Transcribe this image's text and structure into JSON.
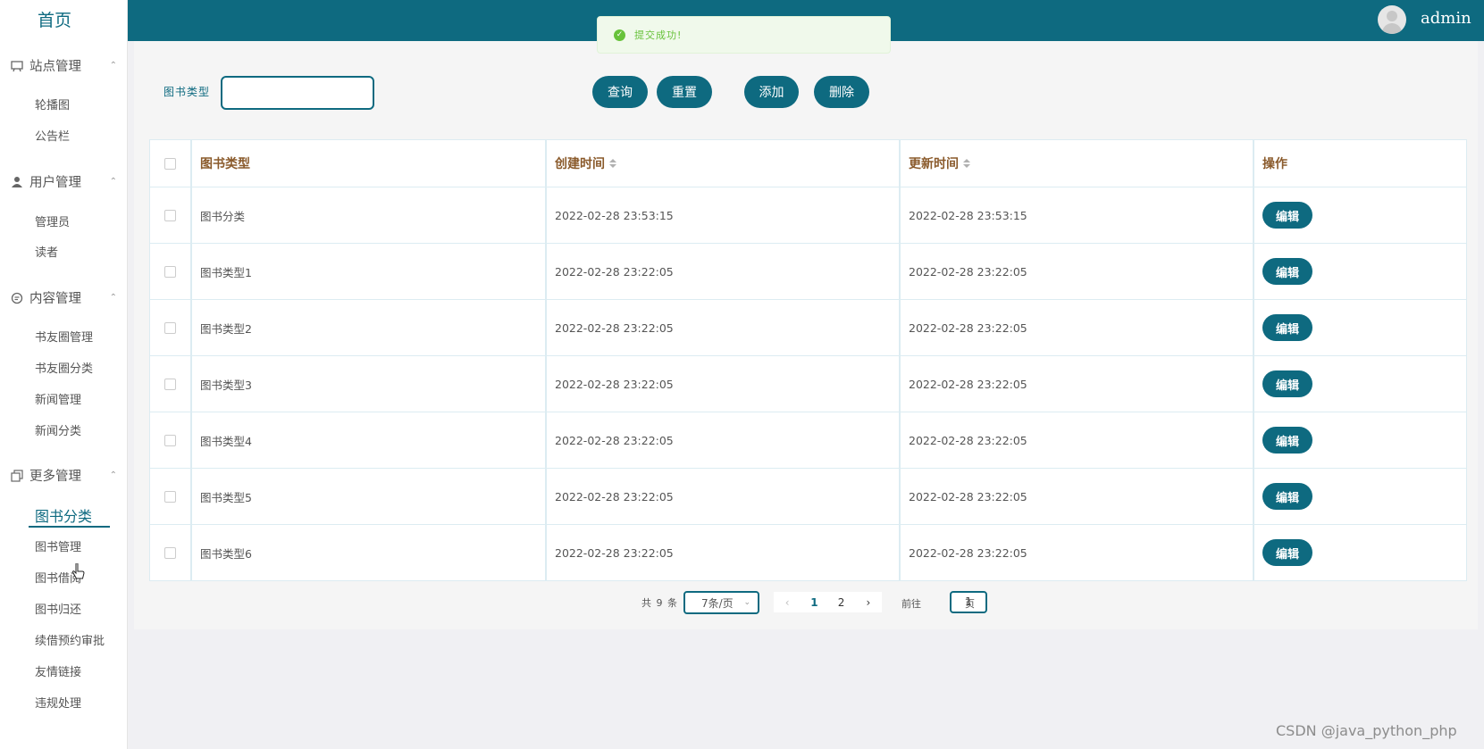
{
  "sidebar": {
    "brand": "首页",
    "groups": [
      {
        "title": "站点管理",
        "icon": "monitor-icon",
        "items": [
          "轮播图",
          "公告栏"
        ]
      },
      {
        "title": "用户管理",
        "icon": "user-icon",
        "items": [
          "管理员",
          "读者"
        ]
      },
      {
        "title": "内容管理",
        "icon": "chat-icon",
        "items": [
          "书友圈管理",
          "书友圈分类",
          "新闻管理",
          "新闻分类"
        ]
      },
      {
        "title": "更多管理",
        "icon": "copy-icon",
        "items": [
          "图书分类",
          "图书管理",
          "图书借阅",
          "图书归还",
          "续借预约审批",
          "友情链接",
          "违规处理"
        ]
      }
    ],
    "active_item": "图书分类"
  },
  "topbar": {
    "username": "admin",
    "avatar_icon": "avatar-icon",
    "color": "#0e6a80"
  },
  "toast": {
    "message": "提交成功!",
    "icon": "check-circle-icon"
  },
  "search": {
    "label": "图书类型",
    "value": ""
  },
  "toolbar": {
    "query": "查询",
    "reset": "重置",
    "add": "添加",
    "delete": "删除"
  },
  "table": {
    "headers": [
      "图书类型",
      "创建时间",
      "更新时间",
      "操作"
    ],
    "rows": [
      {
        "type": "图书分类",
        "created": "2022-02-28 23:53:15",
        "updated": "2022-02-28 23:53:15",
        "action": "编辑"
      },
      {
        "type": "图书类型1",
        "created": "2022-02-28 23:22:05",
        "updated": "2022-02-28 23:22:05",
        "action": "编辑"
      },
      {
        "type": "图书类型2",
        "created": "2022-02-28 23:22:05",
        "updated": "2022-02-28 23:22:05",
        "action": "编辑"
      },
      {
        "type": "图书类型3",
        "created": "2022-02-28 23:22:05",
        "updated": "2022-02-28 23:22:05",
        "action": "编辑"
      },
      {
        "type": "图书类型4",
        "created": "2022-02-28 23:22:05",
        "updated": "2022-02-28 23:22:05",
        "action": "编辑"
      },
      {
        "type": "图书类型5",
        "created": "2022-02-28 23:22:05",
        "updated": "2022-02-28 23:22:05",
        "action": "编辑"
      },
      {
        "type": "图书类型6",
        "created": "2022-02-28 23:22:05",
        "updated": "2022-02-28 23:22:05",
        "action": "编辑"
      }
    ]
  },
  "pagination": {
    "total": "共 9 条",
    "page_size": "7条/页",
    "prev": "‹",
    "pages": [
      "1",
      "2"
    ],
    "next": "›",
    "current_page": "1",
    "goto_label": "前往",
    "goto_value": "1",
    "page_suffix": "页"
  },
  "watermark": "CSDN @java_python_php"
}
